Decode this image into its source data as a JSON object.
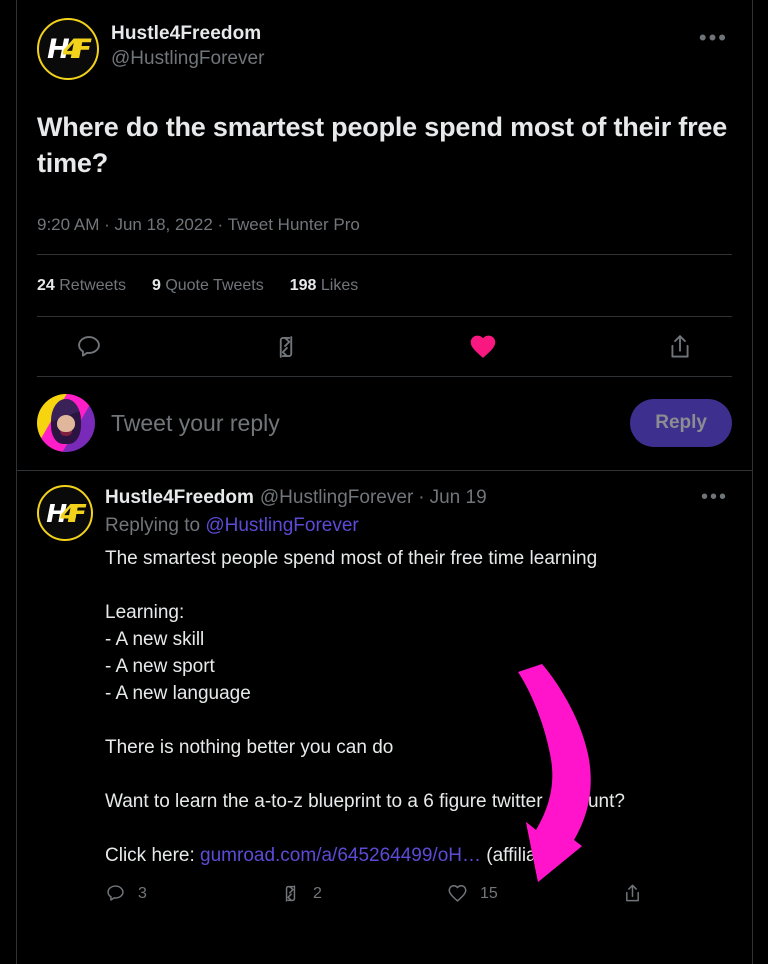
{
  "theme": {
    "background": "#000000",
    "text_primary": "#e7e9ea",
    "text_secondary": "#71767b",
    "border": "#2f3336",
    "link": "#5b4bd6",
    "like_pink": "#f91880",
    "reply_button_bg": "#3d2f8e",
    "annotation_magenta": "#ff14cb",
    "brand_yellow": "#f2d21a"
  },
  "main_tweet": {
    "avatar_name": "hustle4freedom-logo",
    "avatar_initials": {
      "part1": "H",
      "part2": "4",
      "part3": "F"
    },
    "display_name": "Hustle4Freedom",
    "handle": "@HustlingForever",
    "more_label": "•••",
    "body": "Where do the smartest people spend most of their free time?",
    "timestamp": "9:20 AM · Jun 18, 2022 · Tweet Hunter Pro",
    "stats": {
      "retweets_count": "24",
      "retweets_label": "Retweets",
      "quotes_count": "9",
      "quotes_label": "Quote Tweets",
      "likes_count": "198",
      "likes_label": "Likes"
    },
    "actions": [
      {
        "icon": "reply-icon",
        "label": ""
      },
      {
        "icon": "retweet-icon",
        "label": ""
      },
      {
        "icon": "like-icon-filled",
        "label": ""
      },
      {
        "icon": "share-icon",
        "label": ""
      }
    ]
  },
  "composer": {
    "avatar_name": "user-avatar",
    "placeholder": "Tweet your reply",
    "value": "",
    "reply_button_label": "Reply"
  },
  "reply_tweet": {
    "avatar_name": "hustle4freedom-logo",
    "avatar_initials": {
      "part1": "H",
      "part2": "4",
      "part3": "F"
    },
    "display_name": "Hustle4Freedom",
    "handle": "@HustlingForever",
    "separator": "·",
    "date": "Jun 19",
    "more_label": "•••",
    "replying_to_prefix": "Replying to ",
    "replying_to_handle": "@HustlingForever",
    "body": "The smartest people spend most of their free time learning\n\nLearning:\n- A new skill\n- A new sport\n- A new language\n\nThere is nothing better you can do\n\nWant to learn the a-to-z blueprint to a 6 figure twitter account?\n\nClick here: ",
    "link_text": "gumroad.com/a/645264499/oH…",
    "body_tail": " (affiliate)",
    "actions": {
      "reply_count": "3",
      "retweet_count": "2",
      "like_count": "15",
      "share_count": ""
    }
  },
  "annotation": {
    "name": "magenta-arrow",
    "color": "#ff14cb",
    "description": "curved downward arrow"
  }
}
